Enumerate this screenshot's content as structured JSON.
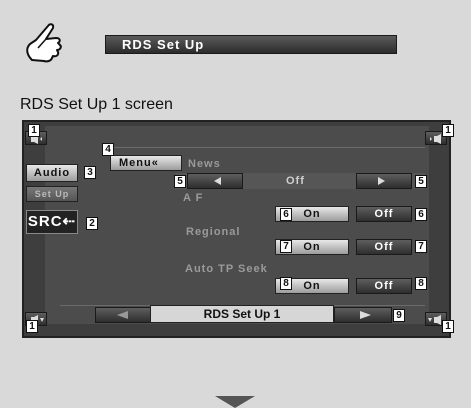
{
  "header": {
    "title": "RDS Set Up"
  },
  "subtitle": "RDS Set Up 1 screen",
  "side": {
    "audio": "Audio",
    "setup": "Set Up",
    "src": "SRC"
  },
  "menu": {
    "label": "Menu"
  },
  "rows": {
    "news": {
      "label": "News",
      "value": "Off"
    },
    "af": {
      "label": "A F",
      "on": "On",
      "off": "Off"
    },
    "regional": {
      "label": "Regional",
      "on": "On",
      "off": "Off"
    },
    "auto_tp": {
      "label": "Auto TP Seek",
      "on": "On",
      "off": "Off"
    }
  },
  "footer": {
    "page_label": "RDS Set Up 1"
  },
  "callouts": {
    "c1": "1",
    "c2": "2",
    "c3": "3",
    "c4": "4",
    "c5": "5",
    "c6": "6",
    "c7": "7",
    "c8": "8",
    "c9": "9"
  },
  "icons": {
    "hand": "pointing-hand-icon",
    "arrow_down": "arrow-down-icon"
  }
}
